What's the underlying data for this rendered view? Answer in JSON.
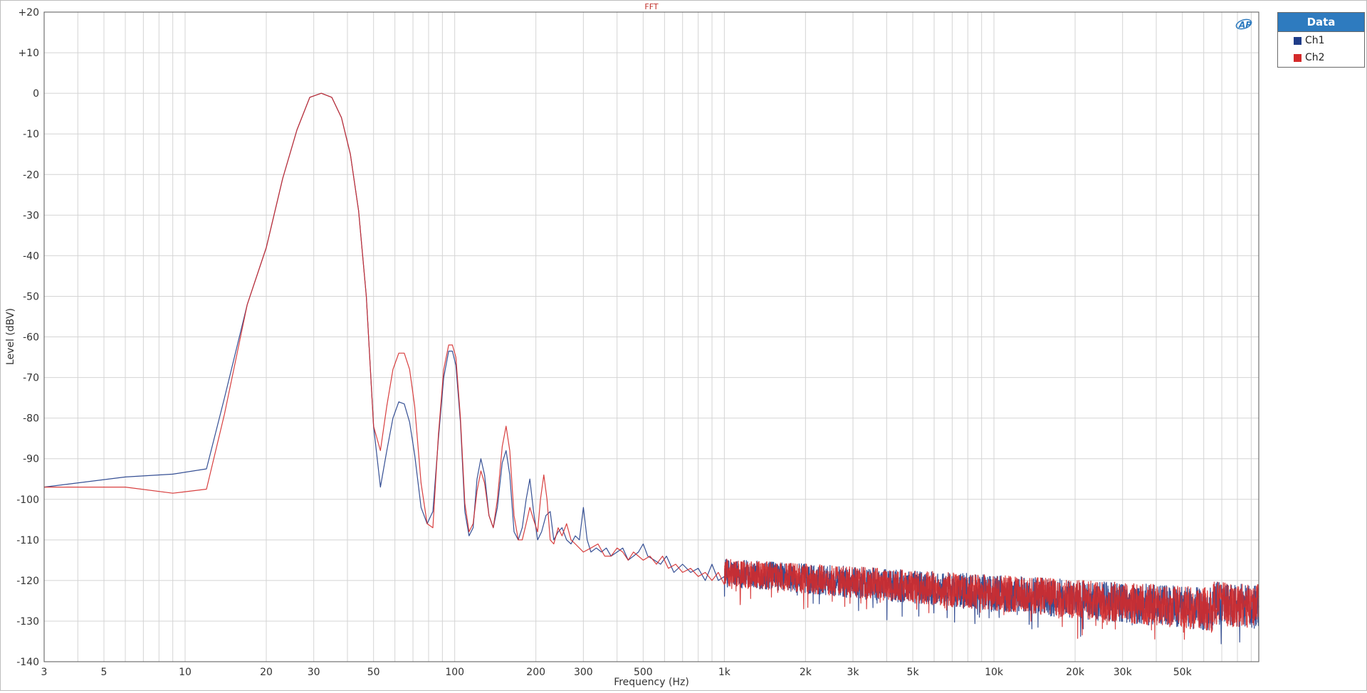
{
  "chart_data": {
    "type": "line",
    "title": "FFT",
    "xlabel": "Frequency (Hz)",
    "ylabel": "Level (dBV)",
    "xscale": "log",
    "xlim": [
      3,
      96000
    ],
    "ylim": [
      -140,
      20
    ],
    "grid": true,
    "legend_position": "top-right (outside plot)",
    "legend_title": "Data",
    "x_ticks": [
      {
        "v": 3,
        "label": "3"
      },
      {
        "v": 5,
        "label": "5"
      },
      {
        "v": 10,
        "label": "10"
      },
      {
        "v": 20,
        "label": "20"
      },
      {
        "v": 30,
        "label": "30"
      },
      {
        "v": 50,
        "label": "50"
      },
      {
        "v": 100,
        "label": "100"
      },
      {
        "v": 200,
        "label": "200"
      },
      {
        "v": 300,
        "label": "300"
      },
      {
        "v": 500,
        "label": "500"
      },
      {
        "v": 1000,
        "label": "1k"
      },
      {
        "v": 2000,
        "label": "2k"
      },
      {
        "v": 3000,
        "label": "3k"
      },
      {
        "v": 5000,
        "label": "5k"
      },
      {
        "v": 10000,
        "label": "10k"
      },
      {
        "v": 20000,
        "label": "20k"
      },
      {
        "v": 30000,
        "label": "30k"
      },
      {
        "v": 50000,
        "label": "50k"
      }
    ],
    "y_ticks": [
      {
        "v": 20,
        "label": "+20"
      },
      {
        "v": 10,
        "label": "+10"
      },
      {
        "v": 0,
        "label": "0"
      },
      {
        "v": -10,
        "label": "-10"
      },
      {
        "v": -20,
        "label": "-20"
      },
      {
        "v": -30,
        "label": "-30"
      },
      {
        "v": -40,
        "label": "-40"
      },
      {
        "v": -50,
        "label": "-50"
      },
      {
        "v": -60,
        "label": "-60"
      },
      {
        "v": -70,
        "label": "-70"
      },
      {
        "v": -80,
        "label": "-80"
      },
      {
        "v": -90,
        "label": "-90"
      },
      {
        "v": -100,
        "label": "-100"
      },
      {
        "v": -110,
        "label": "-110"
      },
      {
        "v": -120,
        "label": "-120"
      },
      {
        "v": -130,
        "label": "-130"
      },
      {
        "v": -140,
        "label": "-140"
      }
    ],
    "series": [
      {
        "name": "Ch1",
        "color": "#1f3c88",
        "points": [
          [
            3,
            -97
          ],
          [
            6,
            -94.5
          ],
          [
            9,
            -93.8
          ],
          [
            12,
            -92.5
          ],
          [
            14,
            -75
          ],
          [
            17,
            -52
          ],
          [
            20,
            -38
          ],
          [
            23,
            -21
          ],
          [
            26,
            -9
          ],
          [
            29,
            -1
          ],
          [
            32,
            0
          ],
          [
            35,
            -1
          ],
          [
            38,
            -6
          ],
          [
            41,
            -15
          ],
          [
            44,
            -29
          ],
          [
            47,
            -50
          ],
          [
            50,
            -82
          ],
          [
            53,
            -97
          ],
          [
            56,
            -88
          ],
          [
            59,
            -80
          ],
          [
            62,
            -76
          ],
          [
            65,
            -76.5
          ],
          [
            68,
            -81
          ],
          [
            71,
            -89
          ],
          [
            75,
            -102
          ],
          [
            79,
            -106
          ],
          [
            83,
            -103
          ],
          [
            87,
            -85
          ],
          [
            91,
            -70
          ],
          [
            95,
            -63.5
          ],
          [
            98,
            -63.5
          ],
          [
            101,
            -67
          ],
          [
            105,
            -81
          ],
          [
            109,
            -103
          ],
          [
            113,
            -109
          ],
          [
            117,
            -107
          ],
          [
            121,
            -95
          ],
          [
            125,
            -90
          ],
          [
            129,
            -94
          ],
          [
            134,
            -104
          ],
          [
            139,
            -107
          ],
          [
            144,
            -102
          ],
          [
            150,
            -91
          ],
          [
            155,
            -88
          ],
          [
            160,
            -94
          ],
          [
            166,
            -108
          ],
          [
            172,
            -110
          ],
          [
            178,
            -107
          ],
          [
            184,
            -100
          ],
          [
            190,
            -95
          ],
          [
            196,
            -103
          ],
          [
            203,
            -110
          ],
          [
            210,
            -108
          ],
          [
            218,
            -104
          ],
          [
            226,
            -103
          ],
          [
            233,
            -110
          ],
          [
            242,
            -108
          ],
          [
            250,
            -107
          ],
          [
            260,
            -110
          ],
          [
            270,
            -111
          ],
          [
            280,
            -109
          ],
          [
            290,
            -110
          ],
          [
            300,
            -102
          ],
          [
            310,
            -110
          ],
          [
            320,
            -113
          ],
          [
            335,
            -112
          ],
          [
            350,
            -113
          ],
          [
            365,
            -112
          ],
          [
            380,
            -114
          ],
          [
            400,
            -113
          ],
          [
            420,
            -112
          ],
          [
            440,
            -115
          ],
          [
            460,
            -114
          ],
          [
            480,
            -113
          ],
          [
            500,
            -111
          ],
          [
            520,
            -114
          ],
          [
            550,
            -115
          ],
          [
            580,
            -116
          ],
          [
            610,
            -114
          ],
          [
            650,
            -118
          ],
          [
            700,
            -116
          ],
          [
            750,
            -118
          ],
          [
            800,
            -117
          ],
          [
            850,
            -120
          ],
          [
            900,
            -116
          ],
          [
            950,
            -120
          ],
          [
            1000,
            -119
          ]
        ]
      },
      {
        "name": "Ch2",
        "color": "#d42a2a",
        "points": [
          [
            3,
            -97
          ],
          [
            6,
            -97
          ],
          [
            9,
            -98.5
          ],
          [
            12,
            -97.5
          ],
          [
            14,
            -79
          ],
          [
            17,
            -52
          ],
          [
            20,
            -38
          ],
          [
            23,
            -21
          ],
          [
            26,
            -9
          ],
          [
            29,
            -1
          ],
          [
            32,
            0
          ],
          [
            35,
            -1
          ],
          [
            38,
            -6
          ],
          [
            41,
            -15
          ],
          [
            44,
            -29
          ],
          [
            47,
            -50
          ],
          [
            50,
            -82
          ],
          [
            53,
            -88
          ],
          [
            56,
            -77
          ],
          [
            59,
            -68
          ],
          [
            62,
            -64
          ],
          [
            65,
            -64
          ],
          [
            68,
            -68
          ],
          [
            71,
            -77
          ],
          [
            75,
            -96
          ],
          [
            79,
            -106
          ],
          [
            83,
            -107
          ],
          [
            87,
            -84
          ],
          [
            91,
            -68
          ],
          [
            95,
            -62
          ],
          [
            98,
            -62
          ],
          [
            101,
            -65
          ],
          [
            105,
            -80
          ],
          [
            109,
            -101
          ],
          [
            113,
            -108
          ],
          [
            117,
            -106
          ],
          [
            121,
            -98
          ],
          [
            125,
            -93
          ],
          [
            129,
            -96
          ],
          [
            134,
            -104
          ],
          [
            139,
            -107
          ],
          [
            144,
            -100
          ],
          [
            150,
            -87
          ],
          [
            155,
            -82
          ],
          [
            160,
            -88
          ],
          [
            166,
            -104
          ],
          [
            172,
            -110
          ],
          [
            178,
            -110
          ],
          [
            184,
            -106
          ],
          [
            190,
            -102
          ],
          [
            196,
            -105
          ],
          [
            203,
            -108
          ],
          [
            208,
            -100
          ],
          [
            214,
            -94
          ],
          [
            220,
            -100
          ],
          [
            226,
            -110
          ],
          [
            233,
            -111
          ],
          [
            242,
            -107
          ],
          [
            250,
            -109
          ],
          [
            260,
            -106
          ],
          [
            270,
            -110
          ],
          [
            280,
            -111
          ],
          [
            300,
            -113
          ],
          [
            320,
            -112
          ],
          [
            340,
            -111
          ],
          [
            360,
            -114
          ],
          [
            380,
            -114
          ],
          [
            400,
            -112
          ],
          [
            420,
            -113
          ],
          [
            440,
            -115
          ],
          [
            460,
            -113
          ],
          [
            480,
            -114
          ],
          [
            500,
            -115
          ],
          [
            530,
            -114
          ],
          [
            560,
            -116
          ],
          [
            590,
            -114
          ],
          [
            620,
            -117
          ],
          [
            660,
            -116
          ],
          [
            700,
            -118
          ],
          [
            750,
            -117
          ],
          [
            800,
            -119
          ],
          [
            850,
            -118
          ],
          [
            900,
            -120
          ],
          [
            950,
            -118
          ],
          [
            1000,
            -121
          ]
        ]
      }
    ],
    "noise_floor": {
      "from_hz": 1000,
      "to_hz": 96000,
      "start_mean_db": -118,
      "end_mean_db": -128,
      "bump_start_hz": 65000,
      "bump_mean_db": -131,
      "spread_db": 5.5
    }
  },
  "logo": "AP-logo-icon",
  "colors": {
    "grid": "#d4d4d4",
    "axis": "#555555",
    "title": "#c0302a",
    "legend_header": "#2e7bbf",
    "ch1": "#1f3c88",
    "ch2": "#d42a2a"
  }
}
